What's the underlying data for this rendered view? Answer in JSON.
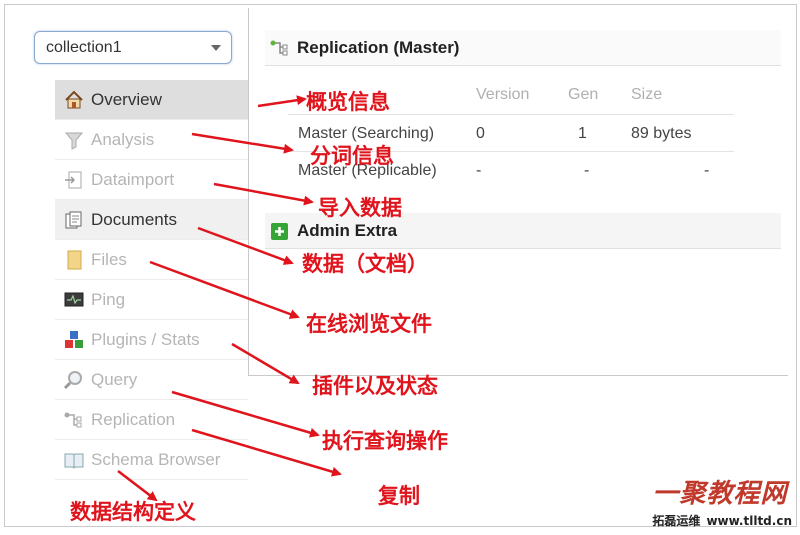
{
  "core_selector": {
    "value": "collection1"
  },
  "menu": [
    {
      "label": "Overview",
      "icon": "home-icon"
    },
    {
      "label": "Analysis",
      "icon": "funnel-icon"
    },
    {
      "label": "Dataimport",
      "icon": "import-icon"
    },
    {
      "label": "Documents",
      "icon": "documents-icon"
    },
    {
      "label": "Files",
      "icon": "file-icon"
    },
    {
      "label": "Ping",
      "icon": "monitor-icon"
    },
    {
      "label": "Plugins / Stats",
      "icon": "blocks-icon"
    },
    {
      "label": "Query",
      "icon": "magnifier-icon"
    },
    {
      "label": "Replication",
      "icon": "replication-icon"
    },
    {
      "label": "Schema Browser",
      "icon": "book-icon"
    }
  ],
  "replication": {
    "title": "Replication (Master)",
    "columns": [
      "Version",
      "Gen",
      "Size"
    ],
    "rows": [
      {
        "name": "Master (Searching)",
        "version": "0",
        "gen": "1",
        "size": "89 bytes"
      },
      {
        "name": "Master (Replicable)",
        "version": "-",
        "gen": "-",
        "size": "-"
      }
    ]
  },
  "admin_extra": {
    "title": "Admin Extra"
  },
  "annotations": {
    "overview": "概览信息",
    "analysis": "分词信息",
    "dataimport": "导入数据",
    "documents": "数据（文档）",
    "files": "在线浏览文件",
    "plugins": "插件以及状态",
    "query": "执行查询操作",
    "replication": "复制",
    "schema": "数据结构定义"
  },
  "watermark": {
    "cn": "一聚教程网",
    "sub": "拓磊运维",
    "url": "www.tlltd.cn"
  },
  "colors": {
    "annotation": "#e0141c",
    "selector_border": "#8aa9cf"
  }
}
